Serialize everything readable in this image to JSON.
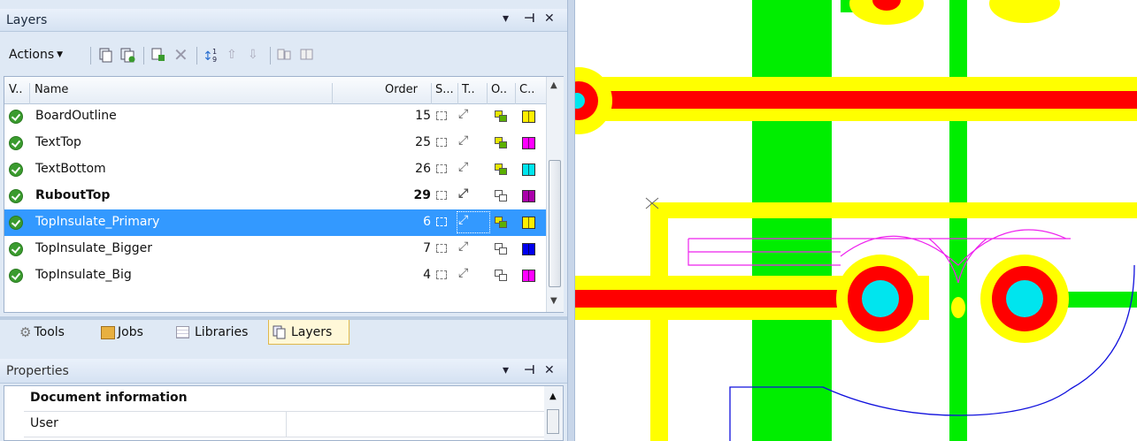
{
  "layers_panel": {
    "title": "Layers",
    "title_controls": {
      "dropdown": "▾",
      "pin": "⊣",
      "close": "✕"
    },
    "toolbar": {
      "actions_label": "Actions",
      "buttons": [
        "new-layer-icon",
        "copy-layer-icon",
        "add-icon",
        "delete-icon",
        "sort-icon",
        "move-up-icon",
        "move-down-icon",
        "split-icon",
        "merge-icon"
      ]
    },
    "columns": {
      "visible": "V..",
      "name": "Name",
      "order": "Order",
      "s": "S...",
      "t": "T..",
      "o": "O..",
      "c": "C.."
    },
    "rows": [
      {
        "name": "BoardOutline",
        "order": "15",
        "color": "#ffee00",
        "bold": false,
        "selected": false
      },
      {
        "name": "TextTop",
        "order": "25",
        "color": "#ff00ff",
        "bold": false,
        "selected": false
      },
      {
        "name": "TextBottom",
        "order": "26",
        "color": "#00e5ee",
        "bold": false,
        "selected": false
      },
      {
        "name": "RuboutTop",
        "order": "29",
        "color": "#aa00aa",
        "bold": true,
        "selected": false
      },
      {
        "name": "TopInsulate_Primary",
        "order": "6",
        "color": "#ffee00",
        "bold": false,
        "selected": true
      },
      {
        "name": "TopInsulate_Bigger",
        "order": "7",
        "color": "#0000ee",
        "bold": false,
        "selected": false
      },
      {
        "name": "TopInsulate_Big",
        "order": "4",
        "color": "#ff00ff",
        "bold": false,
        "selected": false
      }
    ]
  },
  "tabs": [
    {
      "label": "Tools",
      "icon": "gear-icon",
      "active": false
    },
    {
      "label": "Jobs",
      "icon": "jobs-icon",
      "active": false
    },
    {
      "label": "Libraries",
      "icon": "library-icon",
      "active": false
    },
    {
      "label": "Layers",
      "icon": "layers-icon",
      "active": true
    }
  ],
  "properties_panel": {
    "title": "Properties",
    "section": "Document information",
    "rows": [
      {
        "label": "User",
        "value": ""
      }
    ]
  },
  "colors": {
    "selection": "#3399ff",
    "track_red": "#ff0000",
    "pad_cyan": "#00e5ee",
    "insulate_yellow": "#ffff00",
    "copper_green": "#00ee00"
  }
}
